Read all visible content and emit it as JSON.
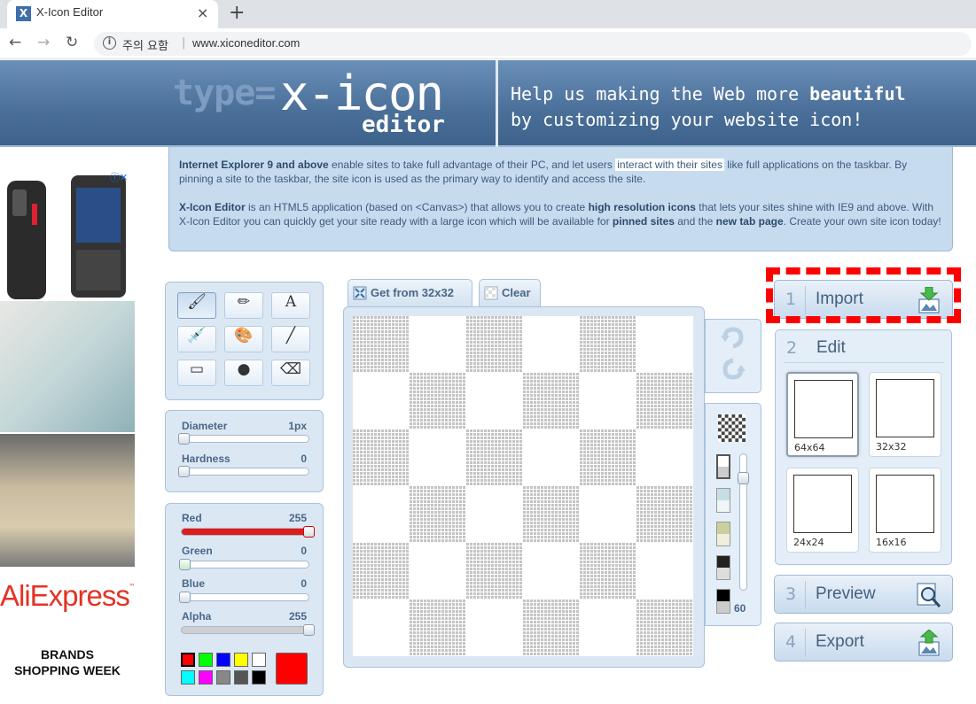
{
  "browser": {
    "tab_title": "X-Icon Editor",
    "tab_close": "×",
    "new_tab": "+",
    "security_label": "주의 요함",
    "url": "www.xiconeditor.com"
  },
  "header": {
    "logo_type": "type=",
    "logo_xicon": "x-icon",
    "logo_editor": "editor",
    "tagline_line1_prefix": "Help us making the Web more ",
    "tagline_line1_bold": "beautiful",
    "tagline_line2": "by customizing your website icon!"
  },
  "intro": {
    "p1_bold": "Internet Explorer 9 and above",
    "p1_a": " enable sites to take full advantage of their PC, and let users ",
    "p1_link": "interact with their sites",
    "p1_b": " like full applications on the taskbar. By pinning a site to the taskbar, the site icon is used as the primary way to identify and access the site.",
    "p2_bold1": "X-Icon Editor",
    "p2_a": " is an HTML5 application (based on <Canvas>) that allows you to create ",
    "p2_bold2": "high resolution icons",
    "p2_b": " that lets your sites shine with IE9 and above. With X-Icon Editor you can quickly get your site ready with a large icon which will be available for ",
    "p2_bold3": "pinned sites",
    "p2_c": " and the ",
    "p2_bold4": "new tab page",
    "p2_d": ". Create your own site icon today!"
  },
  "ads": {
    "adchoices": "ⓘ✕",
    "aliexpress": "AliExpress",
    "aliexpress_tm": "™",
    "brands_line1": "BRANDS",
    "brands_line2": "SHOPPING WEEK"
  },
  "tools": [
    {
      "name": "brush-tool",
      "glyph": "🖌",
      "active": true
    },
    {
      "name": "pencil-tool",
      "glyph": "✏",
      "active": false
    },
    {
      "name": "text-tool",
      "glyph": "A",
      "active": false
    },
    {
      "name": "eyedropper-tool",
      "glyph": "💉",
      "active": false
    },
    {
      "name": "fill-tool",
      "glyph": "🎨",
      "active": false
    },
    {
      "name": "line-tool",
      "glyph": "╱",
      "active": false
    },
    {
      "name": "rectangle-tool",
      "glyph": "▭",
      "active": false
    },
    {
      "name": "ellipse-tool",
      "glyph": "●",
      "active": false
    },
    {
      "name": "eraser-tool",
      "glyph": "⌫",
      "active": false
    }
  ],
  "brush": {
    "diameter_label": "Diameter",
    "diameter_value": "1px",
    "hardness_label": "Hardness",
    "hardness_value": "0"
  },
  "color": {
    "red_label": "Red",
    "red_value": "255",
    "green_label": "Green",
    "green_value": "0",
    "blue_label": "Blue",
    "blue_value": "0",
    "alpha_label": "Alpha",
    "alpha_value": "255",
    "current": "#ff0000",
    "swatches": [
      "#ff0000",
      "#00ff00",
      "#0000ff",
      "#ffff00",
      "#ffffff",
      "#00ffff",
      "#ff00ff",
      "#888888",
      "#555555",
      "#000000"
    ]
  },
  "canvas_tabs": {
    "get_from_label": "Get from 32x32",
    "clear_label": "Clear"
  },
  "zoom": {
    "value": "60"
  },
  "steps": {
    "import_num": "1",
    "import_label": "Import",
    "edit_num": "2",
    "edit_label": "Edit",
    "preview_num": "3",
    "preview_label": "Preview",
    "export_num": "4",
    "export_label": "Export"
  },
  "sizes": [
    {
      "label": "64x64",
      "active": true
    },
    {
      "label": "32x32",
      "active": false
    },
    {
      "label": "24x24",
      "active": false
    },
    {
      "label": "16x16",
      "active": false
    }
  ],
  "colors": {
    "accent": "#4a6f99",
    "highlight": "#ff0000"
  }
}
